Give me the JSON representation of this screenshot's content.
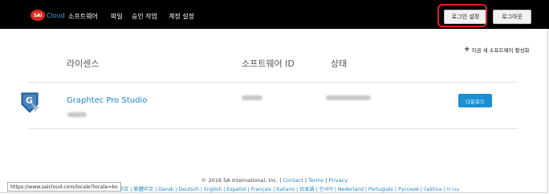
{
  "header": {
    "logo_text": "SAi",
    "cloud_text": "Cloud",
    "nav": [
      "소프트웨어",
      "파일",
      "승인 작업",
      "계정 설정"
    ],
    "license_settings_label": "로그인 설정",
    "logout_label": "로그아웃"
  },
  "main": {
    "activate_label": "지금 새 소프트웨어 활성화",
    "columns": {
      "license": "라이센스",
      "software_id": "소프트웨어 ID",
      "status": "상태"
    },
    "row": {
      "product_name": "Graphtec Pro Studio",
      "download_label": "다운로드"
    }
  },
  "footer": {
    "copyright": "© 2016 SA International, Inc. | ",
    "contact": "Contact",
    "sep1": " | ",
    "terms": "Terms",
    "sep2": " | ",
    "privacy": "Privacy",
    "languages": "中文 | 繁體中文 | Dansk | Deutsch | English | Español | Français | Italiano | 日本語 | 한국어 | Nederland | Português | Русский | čeština | עברית",
    "status_url": "https://www.saicloud.com/locale?locale=ko"
  },
  "colors": {
    "accent": "#1e86c8",
    "topbar": "#000000",
    "highlight": "#e02020",
    "download_button": "#1a8fd1"
  }
}
